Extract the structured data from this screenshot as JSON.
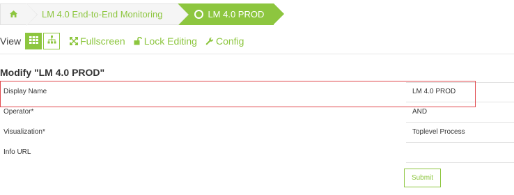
{
  "breadcrumb": {
    "home_icon": "home-icon",
    "parent": "LM 4.0 End-to-End Monitoring",
    "current": "LM 4.0 PROD",
    "status_color": "#8dc63f"
  },
  "toolbar": {
    "view_label": "View",
    "fullscreen": "Fullscreen",
    "lock_editing": "Lock Editing",
    "config": "Config"
  },
  "form": {
    "title": "Modify \"LM 4.0 PROD\"",
    "rows": [
      {
        "label": "Display Name",
        "value": "LM 4.0 PROD"
      },
      {
        "label": "Operator*",
        "value": "AND"
      },
      {
        "label": "Visualization*",
        "value": "Toplevel Process"
      },
      {
        "label": "Info URL",
        "value": ""
      }
    ],
    "submit": "Submit"
  },
  "colors": {
    "accent": "#8dc63f",
    "highlight": "#e0474c"
  }
}
